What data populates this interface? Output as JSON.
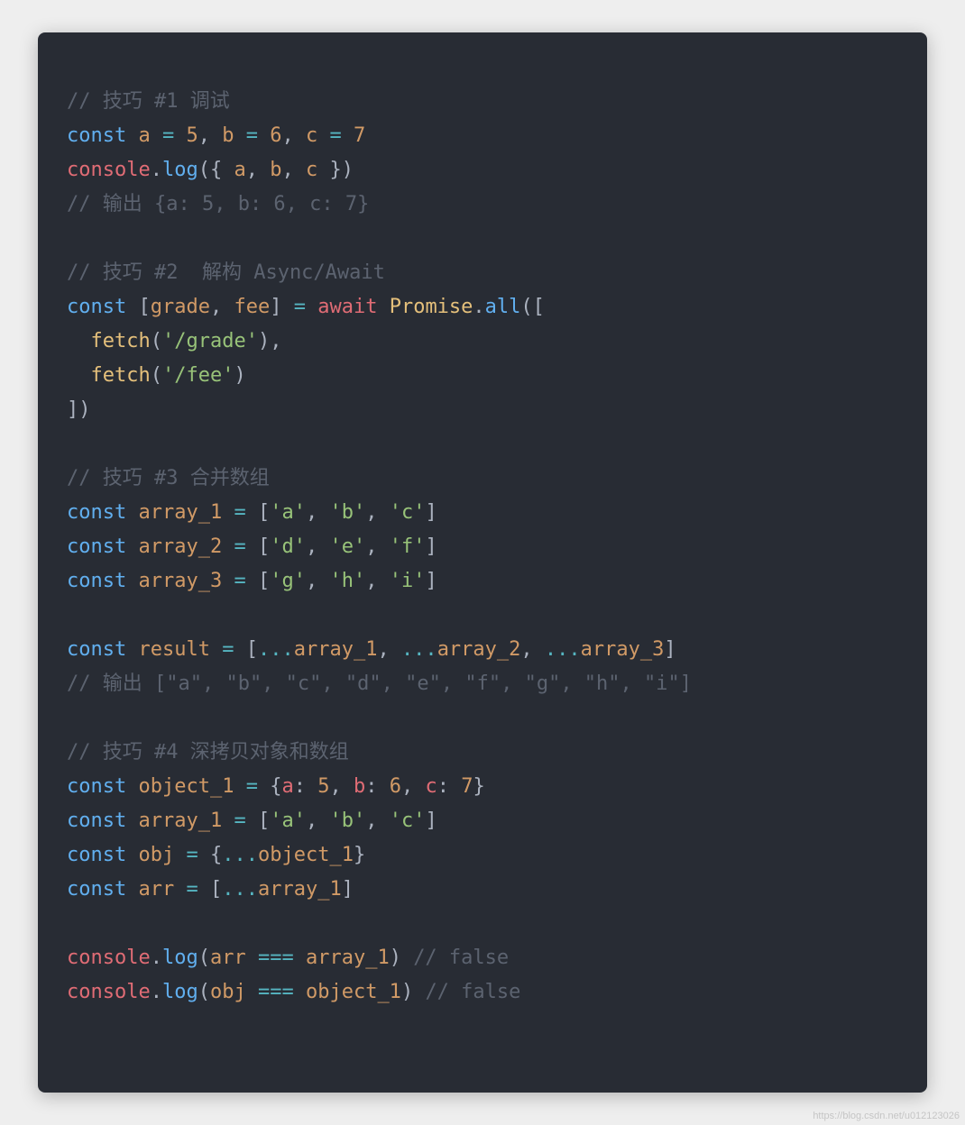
{
  "watermark": "https://blog.csdn.net/u012123026",
  "code": {
    "l1": {
      "comment": "// 技巧 #1 调试"
    },
    "l2": {
      "const": "const",
      "a": "a",
      "eq": "=",
      "n5": "5",
      "comma": ",",
      "b": "b",
      "n6": "6",
      "c": "c",
      "n7": "7"
    },
    "l3": {
      "console": "console",
      "dot": ".",
      "log": "log",
      "lp": "(",
      "lb": "{",
      "a": "a",
      "comma": ",",
      "b": "b",
      "c": "c",
      "rb": "}",
      "rp": ")"
    },
    "l4": {
      "comment": "// 输出 {a: 5, b: 6, c: 7}"
    },
    "l5": {
      "comment": "// 技巧 #2  解构 Async/Await"
    },
    "l6": {
      "const": "const",
      "lb": "[",
      "grade": "grade",
      "comma": ",",
      "fee": "fee",
      "rb": "]",
      "eq": "=",
      "await": "await",
      "promise": "Promise",
      "dot": ".",
      "all": "all",
      "lp": "(",
      "lb2": "["
    },
    "l7": {
      "fetch": "fetch",
      "lp": "(",
      "s": "'/grade'",
      "rp": ")",
      "comma": ","
    },
    "l8": {
      "fetch": "fetch",
      "lp": "(",
      "s": "'/fee'",
      "rp": ")"
    },
    "l9": {
      "rb": "]",
      "rp": ")"
    },
    "l10": {
      "comment": "// 技巧 #3 合并数组"
    },
    "l11": {
      "const": "const",
      "name": "array_1",
      "eq": "=",
      "lb": "[",
      "s1": "'a'",
      "comma": ",",
      "s2": "'b'",
      "s3": "'c'",
      "rb": "]"
    },
    "l12": {
      "const": "const",
      "name": "array_2",
      "eq": "=",
      "lb": "[",
      "s1": "'d'",
      "comma": ",",
      "s2": "'e'",
      "s3": "'f'",
      "rb": "]"
    },
    "l13": {
      "const": "const",
      "name": "array_3",
      "eq": "=",
      "lb": "[",
      "s1": "'g'",
      "comma": ",",
      "s2": "'h'",
      "s3": "'i'",
      "rb": "]"
    },
    "l14": {
      "const": "const",
      "name": "result",
      "eq": "=",
      "lb": "[",
      "spread": "...",
      "a1": "array_1",
      "comma": ",",
      "a2": "array_2",
      "a3": "array_3",
      "rb": "]"
    },
    "l15": {
      "comment": "// 输出 [\"a\", \"b\", \"c\", \"d\", \"e\", \"f\", \"g\", \"h\", \"i\"]"
    },
    "l16": {
      "comment": "// 技巧 #4 深拷贝对象和数组"
    },
    "l17": {
      "const": "const",
      "name": "object_1",
      "eq": "=",
      "lb": "{",
      "a": "a",
      "colon": ":",
      "n5": "5",
      "comma": ",",
      "b": "b",
      "n6": "6",
      "c": "c",
      "n7": "7",
      "rb": "}"
    },
    "l18": {
      "const": "const",
      "name": "array_1",
      "eq": "=",
      "lb": "[",
      "s1": "'a'",
      "comma": ",",
      "s2": "'b'",
      "s3": "'c'",
      "rb": "]"
    },
    "l19": {
      "const": "const",
      "name": "obj",
      "eq": "=",
      "lb": "{",
      "spread": "...",
      "ref": "object_1",
      "rb": "}"
    },
    "l20": {
      "const": "const",
      "name": "arr",
      "eq": "=",
      "lb": "[",
      "spread": "...",
      "ref": "array_1",
      "rb": "]"
    },
    "l21": {
      "console": "console",
      "dot": ".",
      "log": "log",
      "lp": "(",
      "v1": "arr",
      "eqeq": "===",
      "v2": "array_1",
      "rp": ")",
      "comment": "// false"
    },
    "l22": {
      "console": "console",
      "dot": ".",
      "log": "log",
      "lp": "(",
      "v1": "obj",
      "eqeq": "===",
      "v2": "object_1",
      "rp": ")",
      "comment": "// false"
    }
  }
}
